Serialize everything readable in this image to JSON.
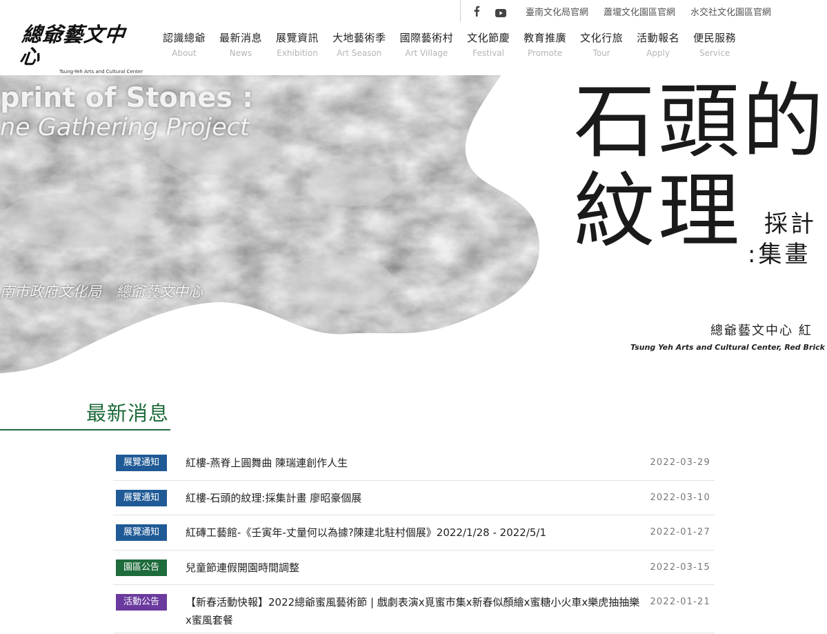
{
  "topbar": {
    "social": [
      {
        "icon": "facebook-icon"
      },
      {
        "icon": "youtube-icon"
      }
    ],
    "links": [
      "臺南文化局官網",
      "蕭壠文化園區官網",
      "水交社文化園區官網"
    ]
  },
  "logo": {
    "mark": "總爺藝文中心",
    "sub": "Tsung-Yeh Arts and Cultural Center"
  },
  "nav": [
    {
      "zh": "認識總爺",
      "en": "About"
    },
    {
      "zh": "最新消息",
      "en": "News"
    },
    {
      "zh": "展覽資訊",
      "en": "Exhibition"
    },
    {
      "zh": "大地藝術季",
      "en": "Art Season"
    },
    {
      "zh": "國際藝術村",
      "en": "Art Village"
    },
    {
      "zh": "文化節慶",
      "en": "Festival"
    },
    {
      "zh": "教育推廣",
      "en": "Promote"
    },
    {
      "zh": "文化行旅",
      "en": "Tour"
    },
    {
      "zh": "活動報名",
      "en": "Apply"
    },
    {
      "zh": "便民服務",
      "en": "Service"
    }
  ],
  "hero": {
    "en_title": "print of Stones :",
    "en_sub": "ne Gathering Project",
    "org_left": "南市政府文化局　總爺藝文中心",
    "zh_title_1": "石頭的",
    "zh_title_2": "紋理",
    "zh_sub_1": "採計",
    "zh_sub_2": ":集畫",
    "org_right": "總爺藝文中心 紅",
    "org_right_en": "Tsung Yeh Arts and Cultural Center, Red Brick O"
  },
  "news": {
    "heading": "最新消息",
    "items": [
      {
        "category": "展覽通知",
        "color": "#1f5a96",
        "title": "紅樓-燕脊上圓舞曲 陳瑞連創作人生",
        "date": "2022-03-29"
      },
      {
        "category": "展覽通知",
        "color": "#1f5a96",
        "title": "紅樓-石頭的紋理:採集計畫 廖昭豪個展",
        "date": "2022-03-10"
      },
      {
        "category": "展覽通知",
        "color": "#1f5a96",
        "title": "紅磚工藝館-《壬寅年-丈量何以為據?陳建北駐村個展》2022/1/28 - 2022/5/1",
        "date": "2022-01-27"
      },
      {
        "category": "園區公告",
        "color": "#1e6b3b",
        "title": "兒童節連假開園時間調整",
        "date": "2022-03-15"
      },
      {
        "category": "活動公告",
        "color": "#6a3a9e",
        "title": "【新春活動快報】2022總爺蜜風藝術節 | 戲劇表演x覓蜜市集x新春似顏繪x蜜糖小火車x樂虎抽抽樂x蜜風套餐",
        "date": "2022-01-21"
      }
    ]
  }
}
